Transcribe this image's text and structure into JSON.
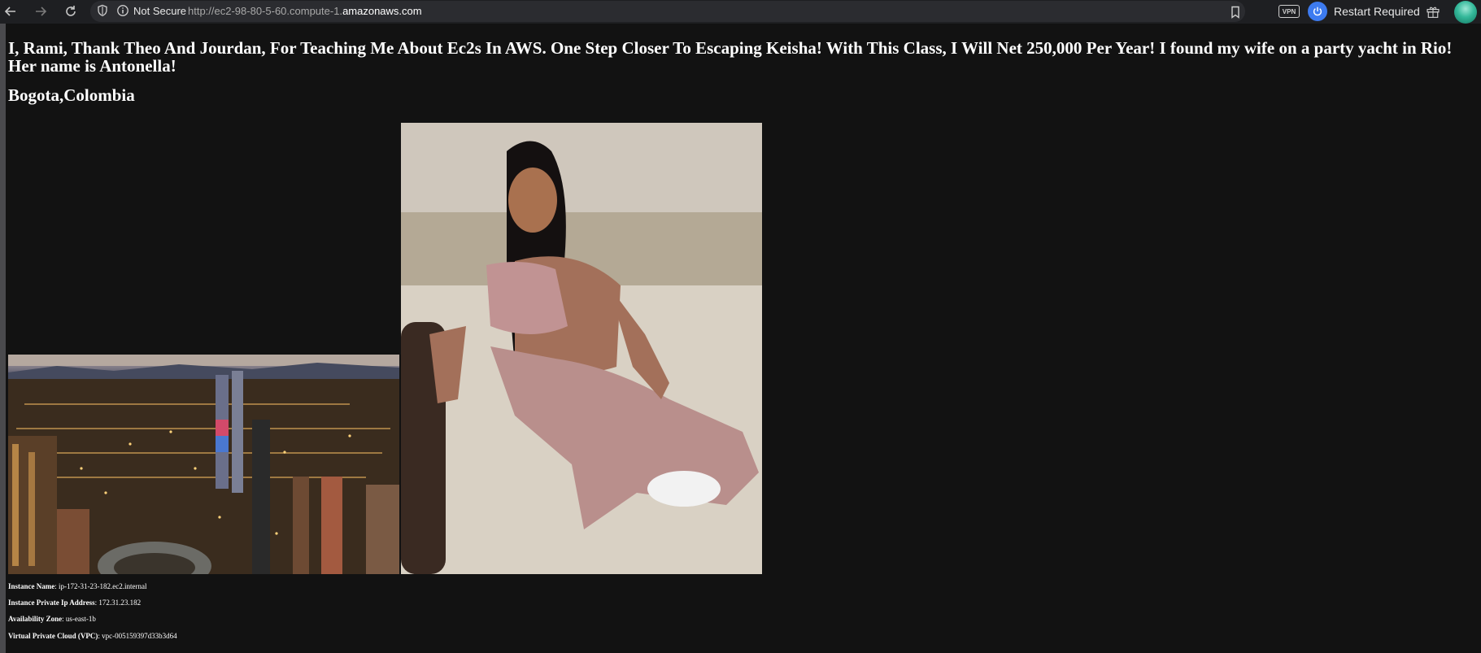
{
  "browser": {
    "security_label": "Not Secure",
    "url_prefix": "http://ec2-98-80-5-60.compute-1.",
    "url_domain": "amazonaws.com",
    "vpn_label": "VPN",
    "restart_label": "Restart Required",
    "icons": [
      "back-icon",
      "forward-icon",
      "reload-icon",
      "shield-icon",
      "info-icon",
      "bookmark-icon",
      "power-icon",
      "gift-icon"
    ]
  },
  "page": {
    "heading": "I, Rami, Thank Theo And Jourdan, For Teaching Me About Ec2s In AWS. One Step Closer To Escaping Keisha! With This Class, I Will Net 250,000 Per Year! I found my wife on a party yacht in Rio! Her name is Antonella!",
    "location": "Bogota,Colombia",
    "instance": {
      "name_label": "Instance Name",
      "name_value": "ip-172-31-23-182.ec2.internal",
      "ip_label": "Instance Private Ip Address",
      "ip_value": "172.31.23.182",
      "zone_label": "Availability Zone",
      "zone_value": "us-east-1b",
      "vpc_label": "Virtual Private Cloud (VPC)",
      "vpc_value": "vpc-005159397d33b3d64"
    }
  }
}
